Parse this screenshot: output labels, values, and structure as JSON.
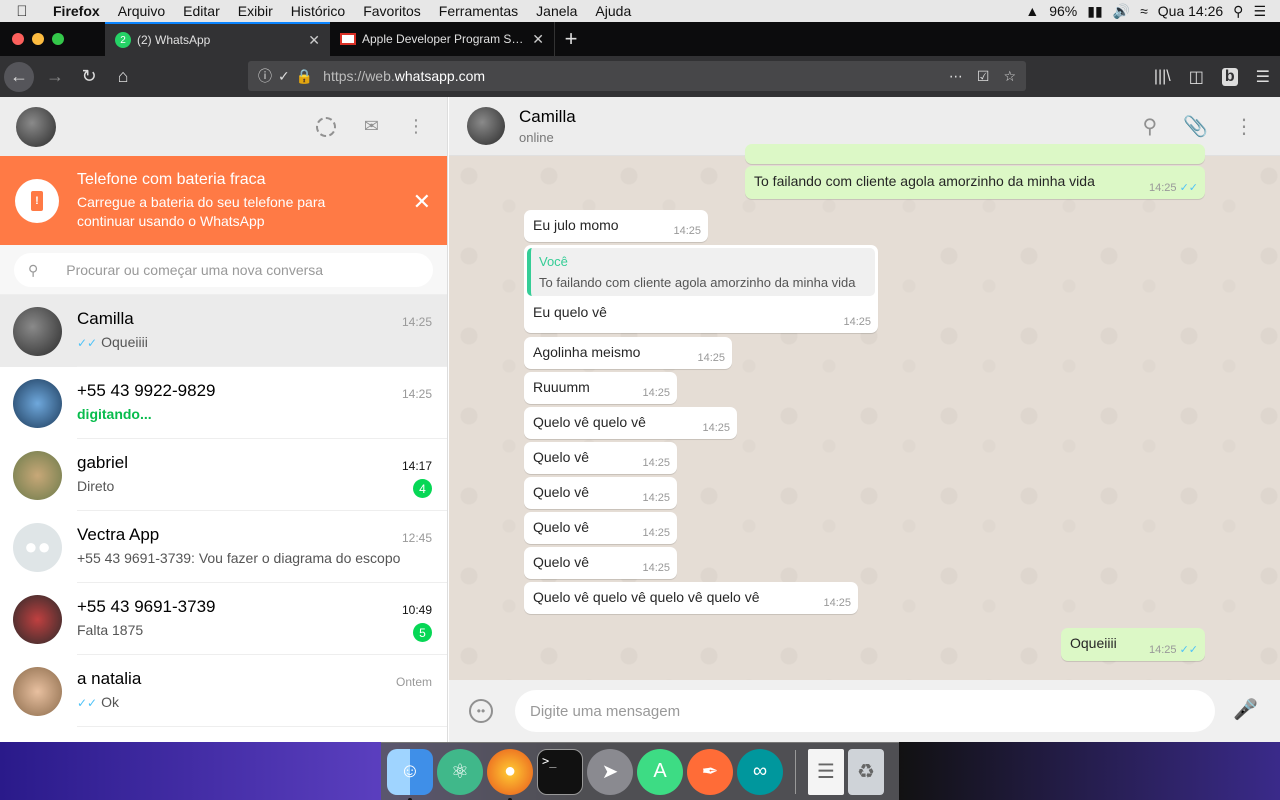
{
  "menubar": {
    "app_name": "Firefox",
    "items": [
      "Arquivo",
      "Editar",
      "Exibir",
      "Histórico",
      "Favoritos",
      "Ferramentas",
      "Janela",
      "Ajuda"
    ],
    "battery": "96%",
    "clock": "Qua 14:26"
  },
  "tabs": [
    {
      "label": "(2) WhatsApp",
      "badge": "2"
    },
    {
      "label": "Apple Developer Program Supp"
    }
  ],
  "navbar": {
    "url_prefix": "https://web.",
    "url_domain": "whatsapp.com"
  },
  "sidebar": {
    "banner": {
      "title": "Telefone com bateria fraca",
      "subtitle": "Carregue a bateria do seu telefone para continuar usando o WhatsApp"
    },
    "search_placeholder": "Procurar ou começar uma nova conversa",
    "chats": [
      {
        "name": "Camilla",
        "time": "14:25",
        "message": "Oqueiiii",
        "ticks": true,
        "active": true
      },
      {
        "name": "+55 43 9922-9829",
        "time": "14:25",
        "message": "digitando...",
        "typing": true
      },
      {
        "name": "gabriel",
        "time": "14:17",
        "message": "Direto",
        "unread": "4"
      },
      {
        "name": "Vectra App",
        "time": "12:45",
        "message": "+55 43 9691-3739: Vou fazer o diagrama do escopo"
      },
      {
        "name": "+55 43 9691-3739",
        "time": "10:49",
        "message": "Falta 1875",
        "unread": "5"
      },
      {
        "name": "a natalia",
        "time": "Ontem",
        "message": "Ok",
        "ticks": true
      }
    ]
  },
  "conversation": {
    "contact_name": "Camilla",
    "status": "online",
    "messages": [
      {
        "dir": "out",
        "text": "To failando com cliente agola amorzinho da minha vida",
        "time": "14:25"
      },
      {
        "dir": "in",
        "text": "Eu julo momo",
        "time": "14:25"
      },
      {
        "dir": "in",
        "quote_author": "Você",
        "quote_text": "To failando com cliente agola amorzinho da minha vida",
        "text": "Eu quelo vê",
        "time": "14:25"
      },
      {
        "dir": "in",
        "text": "Agolinha meismo",
        "time": "14:25"
      },
      {
        "dir": "in",
        "text": "Ruuumm",
        "time": "14:25"
      },
      {
        "dir": "in",
        "text": "Quelo vê quelo vê",
        "time": "14:25"
      },
      {
        "dir": "in",
        "text": "Quelo vê",
        "time": "14:25"
      },
      {
        "dir": "in",
        "text": "Quelo vê",
        "time": "14:25"
      },
      {
        "dir": "in",
        "text": "Quelo vê",
        "time": "14:25"
      },
      {
        "dir": "in",
        "text": "Quelo vê",
        "time": "14:25"
      },
      {
        "dir": "in",
        "text": "Quelo vê quelo vê quelo vê quelo vê",
        "time": "14:25"
      },
      {
        "dir": "out",
        "text": "Oqueiiii",
        "time": "14:25"
      }
    ],
    "input_placeholder": "Digite uma mensagem"
  },
  "dock": {
    "apps": [
      "finder-icon",
      "atom-icon",
      "firefox-icon",
      "terminal-icon",
      "launchpad-icon",
      "android-studio-icon",
      "postman-icon",
      "arduino-icon",
      "document-icon",
      "trash-icon"
    ]
  }
}
